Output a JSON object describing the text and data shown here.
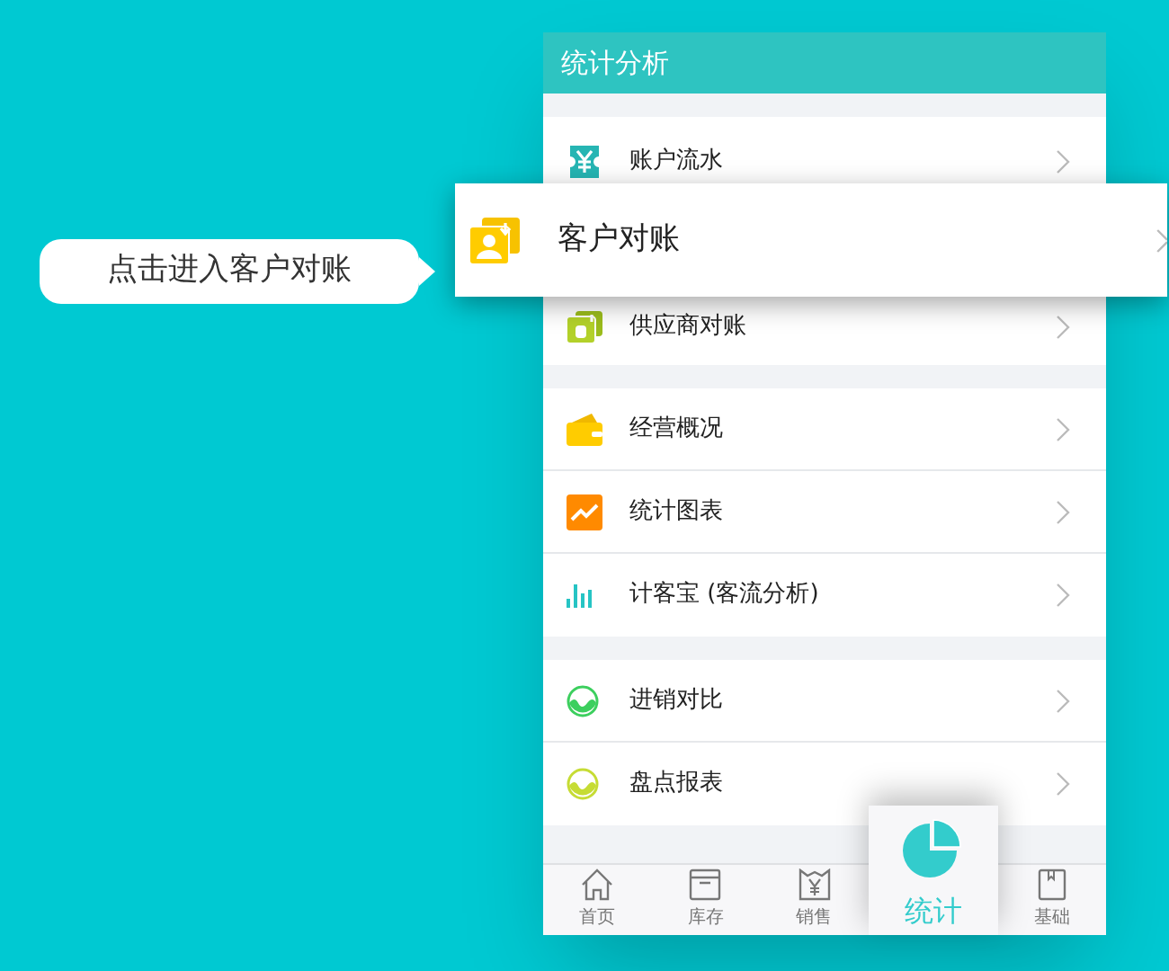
{
  "header": {
    "title": "统计分析"
  },
  "callout": {
    "text": "点击进入客户对账"
  },
  "sections": [
    {
      "items": [
        {
          "label": "账户流水",
          "kind": "row"
        },
        {
          "label": "客户对账",
          "kind": "zoomed"
        },
        {
          "label": "供应商对账",
          "kind": "row"
        }
      ]
    },
    {
      "items": [
        {
          "label": "经营概况",
          "kind": "row"
        },
        {
          "label": "统计图表",
          "kind": "row"
        },
        {
          "label": "计客宝 (客流分析)",
          "kind": "row"
        }
      ]
    },
    {
      "items": [
        {
          "label": "进销对比",
          "kind": "row"
        },
        {
          "label": "盘点报表",
          "kind": "row"
        }
      ]
    }
  ],
  "tabs": [
    {
      "label": "首页",
      "selected": false
    },
    {
      "label": "库存",
      "selected": false
    },
    {
      "label": "销售",
      "selected": false
    },
    {
      "label": "统计",
      "selected": true
    },
    {
      "label": "基础",
      "selected": false
    }
  ]
}
